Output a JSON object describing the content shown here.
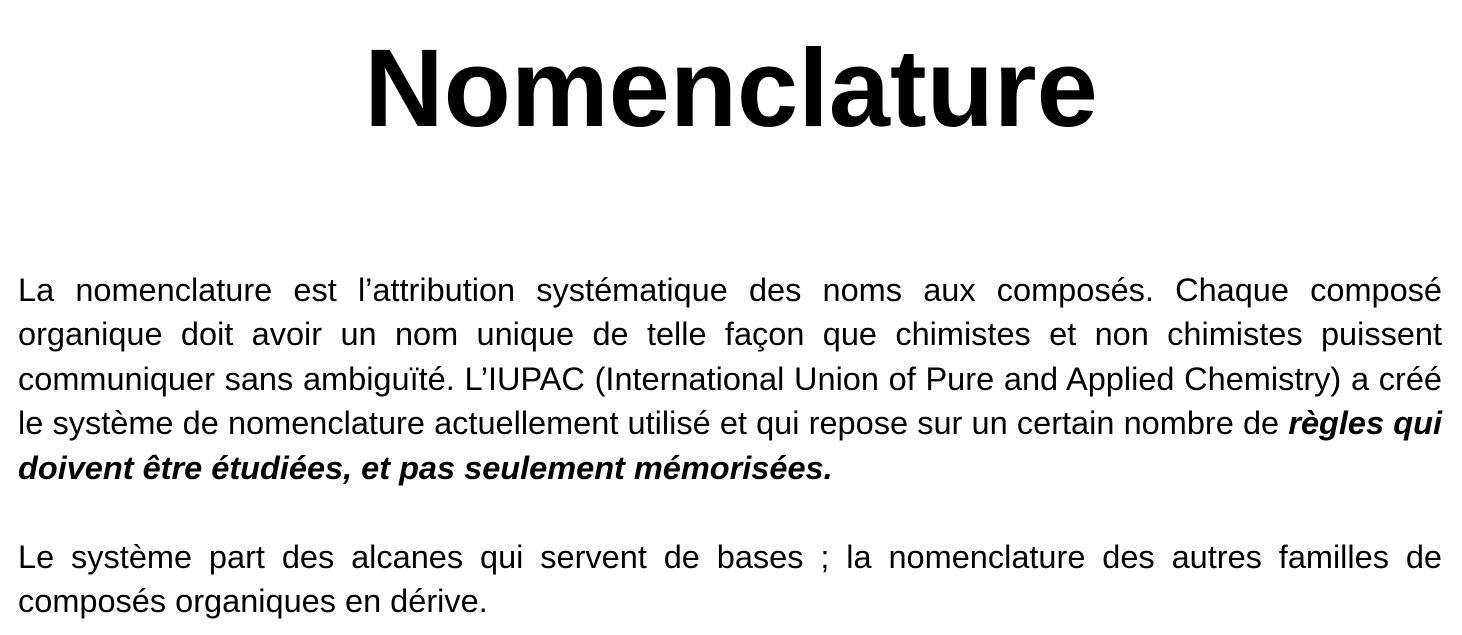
{
  "document": {
    "title": "Nomenclature",
    "paragraph1": {
      "text": "La nomenclature est l’attribution systématique des noms aux composés. Chaque composé organique doit avoir un nom unique de telle façon que chimistes et non chimistes puissent communiquer sans ambiguïté. L’IUPAC (International Union of Pure and Applied Chemistry) a créé le système de nomenclature actuellement utilisé et qui repose sur un certain nombre de ",
      "emphasis": "règles qui doivent être étudiées, et pas seulement mémorisées."
    },
    "paragraph2": {
      "text": "Le système part des alcanes qui servent de bases ; la nomenclature des autres familles de composés organiques en dérive."
    }
  }
}
